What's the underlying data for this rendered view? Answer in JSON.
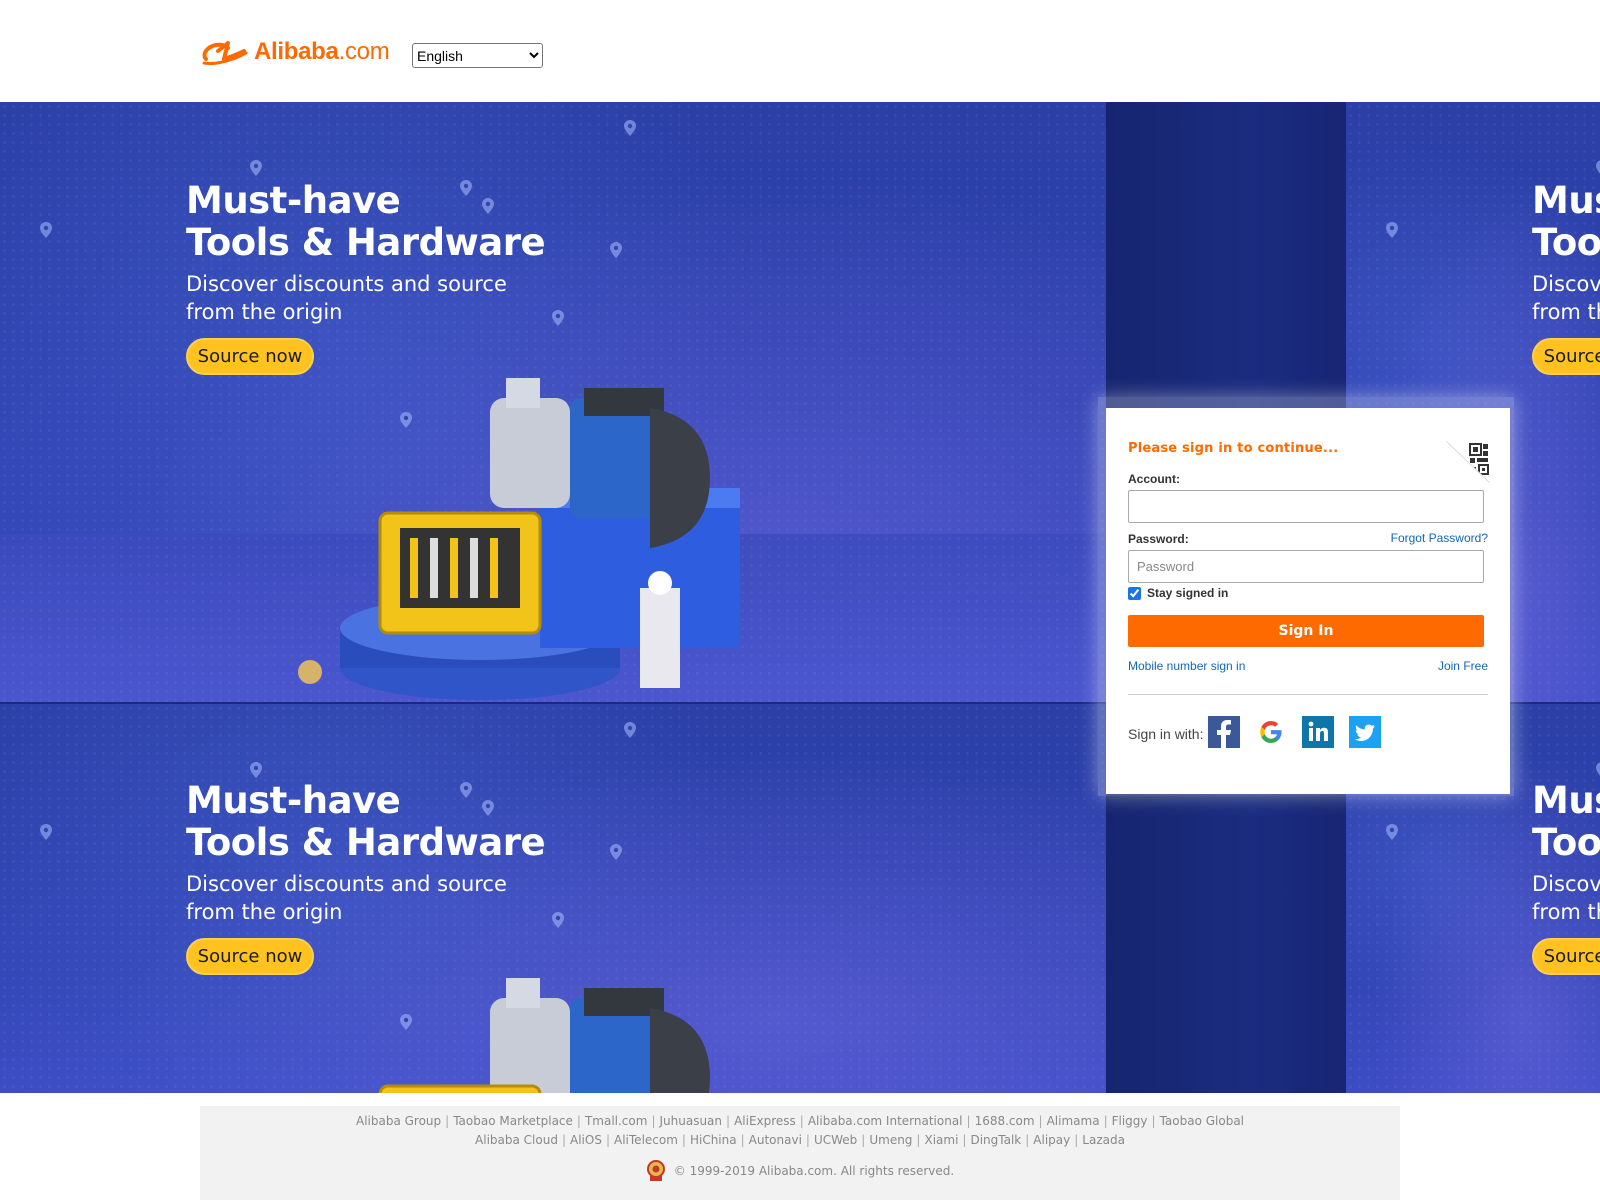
{
  "header": {
    "logo": {
      "text": "Alibaba",
      "suffix": ".com",
      "color": "#ff6a00"
    },
    "language": {
      "selected": "English",
      "options": [
        "English"
      ]
    }
  },
  "banner": {
    "title_line1": "Must-have",
    "title_line2": "Tools & Hardware",
    "subtitle_line1": "Discover discounts and source",
    "subtitle_line2": "from the origin",
    "cta": "Source now",
    "accent_color": "#ffc21f"
  },
  "login": {
    "notice": "Please sign in to continue...",
    "account_label": "Account:",
    "account_value": "",
    "password_label": "Password:",
    "password_placeholder": "Password",
    "forgot": "Forgot Password?",
    "stay_signed_in": "Stay signed in",
    "stay_signed_in_checked": true,
    "sign_in": "Sign In",
    "mobile_sign_in": "Mobile number sign in",
    "join_free": "Join Free",
    "sign_in_with": "Sign in with:",
    "social": [
      {
        "name": "facebook-icon",
        "color": "#3b5998"
      },
      {
        "name": "google-icon",
        "color": "#4285f4"
      },
      {
        "name": "linkedin-icon",
        "color": "#0e76a8"
      },
      {
        "name": "twitter-icon",
        "color": "#1da1f2"
      }
    ],
    "primary_color": "#ff6a00",
    "link_color": "#1467b2"
  },
  "footer": {
    "links_row1": [
      "Alibaba Group",
      "Taobao Marketplace",
      "Tmall.com",
      "Juhuasuan",
      "AliExpress",
      "Alibaba.com International",
      "1688.com",
      "Alimama",
      "Fliggy",
      "Taobao Global"
    ],
    "links_row2": [
      "Alibaba Cloud",
      "AliOS",
      "AliTelecom",
      "HiChina",
      "Autonavi",
      "UCWeb",
      "Umeng",
      "Xiami",
      "DingTalk",
      "Alipay",
      "Lazada"
    ],
    "copyright": "© 1999-2019 Alibaba.com. All rights reserved."
  }
}
